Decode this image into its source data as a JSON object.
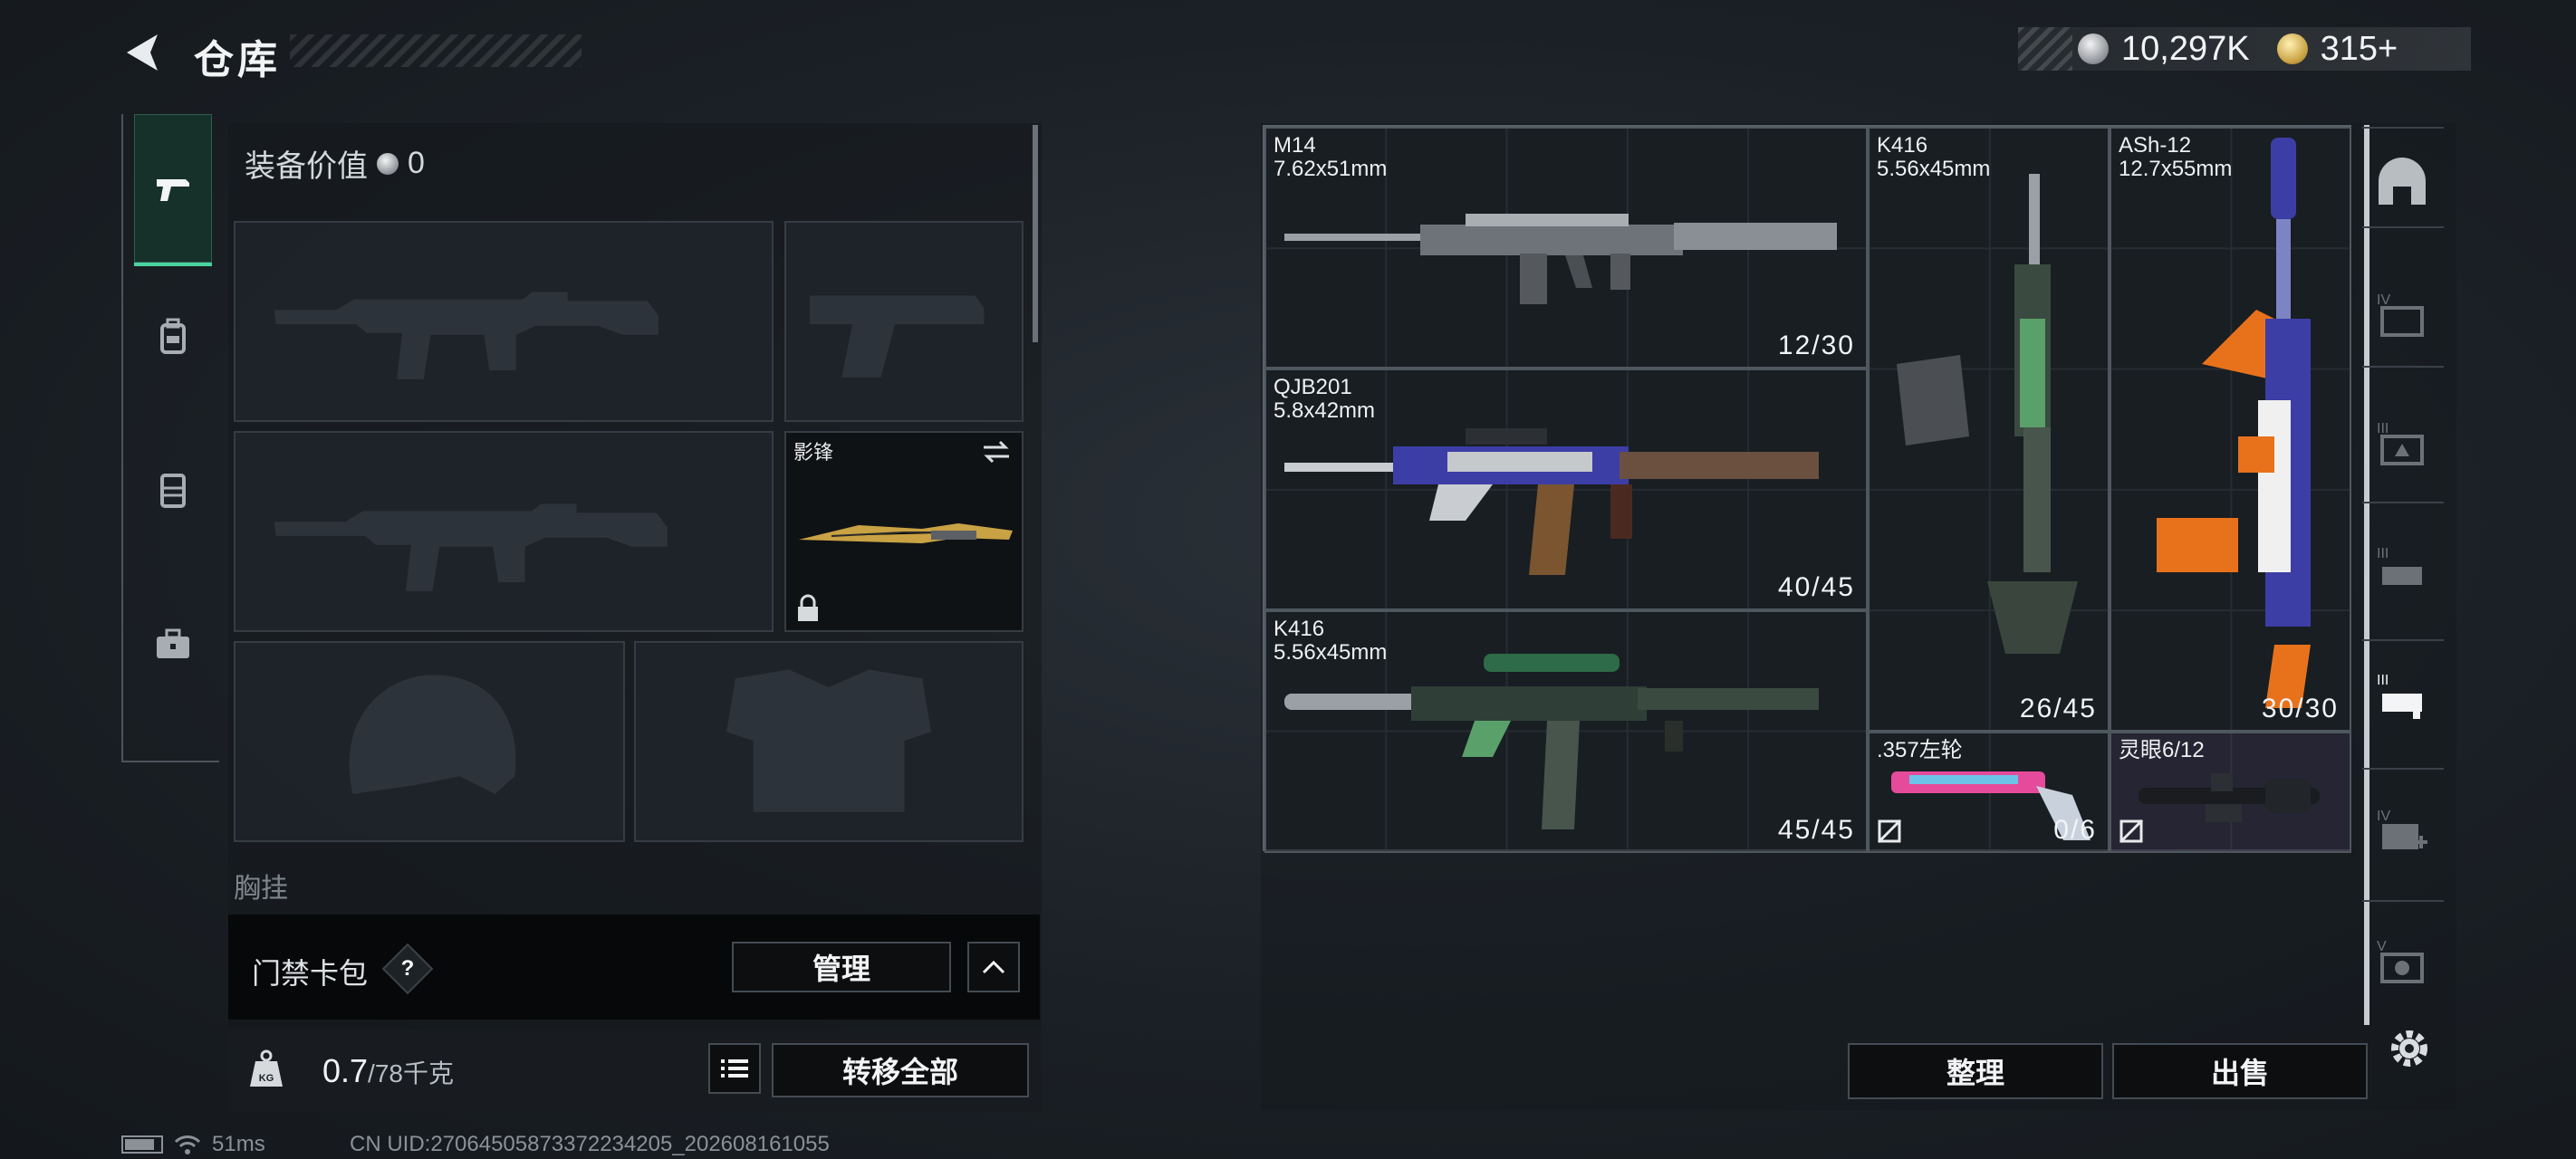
{
  "header": {
    "title": "仓库"
  },
  "currency": {
    "silver": "10,297K",
    "gold": "315+"
  },
  "left_tabs": [
    {
      "name": "weapons",
      "icon": "pistol-icon",
      "active": true
    },
    {
      "name": "backpack",
      "icon": "backpack-icon",
      "active": false
    },
    {
      "name": "vest",
      "icon": "vest-icon",
      "active": false
    },
    {
      "name": "case",
      "icon": "briefcase-icon",
      "active": false
    }
  ],
  "equipment": {
    "value_label": "装备价值",
    "value": "0",
    "melee": {
      "label": "影锋"
    },
    "chest_label": "胸挂"
  },
  "keycard": {
    "label": "门禁卡包",
    "help": "?",
    "manage_label": "管理"
  },
  "weight": {
    "current": "0.7",
    "max": "/78千克"
  },
  "transfer_label": "转移全部",
  "status": {
    "ping": "51ms",
    "uid": "CN UID:27064505873372234205_202608161055"
  },
  "stash_items": [
    {
      "name": "M14",
      "caliber": "7.62x51mm",
      "count": "12/30"
    },
    {
      "name": "QJB201",
      "caliber": "5.8x42mm",
      "count": "40/45"
    },
    {
      "name": "K416",
      "caliber": "5.56x45mm",
      "count": "45/45"
    },
    {
      "name": "K416",
      "caliber": "5.56x45mm",
      "count": "26/45"
    },
    {
      "name": "ASh-12",
      "caliber": "12.7x55mm",
      "count": "30/30"
    },
    {
      "name": ".357左轮",
      "caliber": "",
      "count": "0/6"
    },
    {
      "name": "灵眼6/12",
      "caliber": "",
      "count": ""
    }
  ],
  "actions": {
    "tidy_label": "整理",
    "sell_label": "出售"
  },
  "colors": {
    "accent": "#49d3a0",
    "ash_orange": "#e8721c",
    "ash_blue": "#3c3ea6"
  }
}
